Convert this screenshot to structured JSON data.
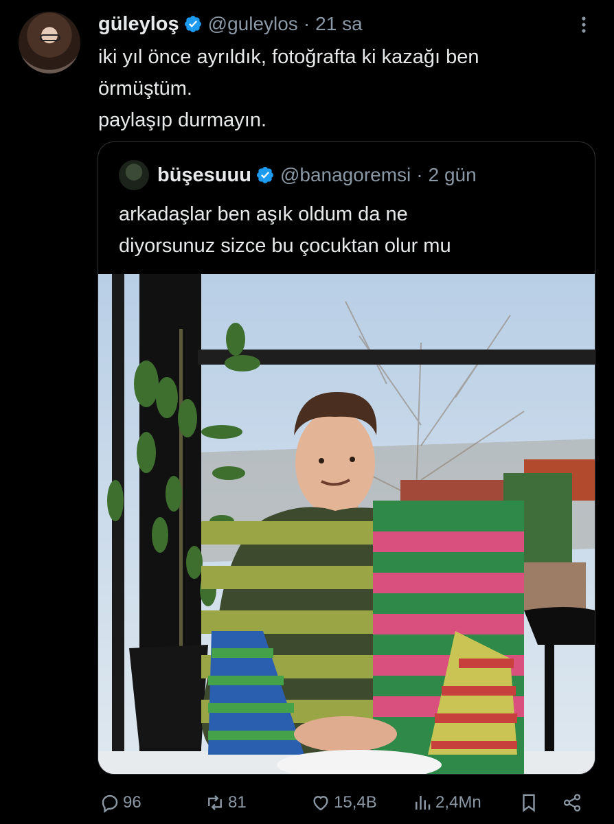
{
  "tweet": {
    "author_name": "güleyloş",
    "author_handle": "@guleylos",
    "separator": "·",
    "time": "21 sa",
    "text_lines": [
      "iki yıl önce ayrıldık, fotoğrafta ki kazağı ben",
      "örmüştüm.",
      "paylaşıp durmayın."
    ]
  },
  "quoted": {
    "author_name": "büşesuuu",
    "author_handle": "@banagoremsi",
    "separator": "·",
    "time": "2 gün",
    "text_lines": [
      "arkadaşlar ben aşık oldum da ne",
      "diyorsunuz sizce bu çocuktan olur mu"
    ]
  },
  "actions": {
    "replies": "96",
    "reposts": "81",
    "likes": "15,4B",
    "views": "2,4Mn"
  },
  "colors": {
    "background": "#000000",
    "text_primary": "#e7e9ea",
    "text_secondary": "#8b98a5",
    "verified_badge": "#1d9bf0",
    "border": "#2f3336"
  },
  "icons": [
    "verified-badge-icon",
    "more-options-icon",
    "reply-icon",
    "repost-icon",
    "like-icon",
    "views-icon",
    "bookmark-icon",
    "share-icon"
  ]
}
